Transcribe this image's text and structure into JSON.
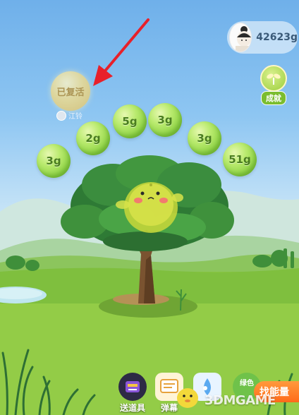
{
  "user": {
    "energy_total": "42623g",
    "avatar": "user-avatar"
  },
  "achievement": {
    "label": "成就",
    "icon": "sprout-medal-icon"
  },
  "revived_ball": {
    "label": "已复活",
    "friend_name": "江铃"
  },
  "energy_balls": [
    "5g",
    "3g",
    "2g",
    "3g",
    "3g",
    "51g"
  ],
  "dock": {
    "send_props": "送道具",
    "bullet": "弹幕",
    "green_tag": "绿色",
    "find_energy": "找能量"
  },
  "watermark": "3DMGAME",
  "colors": {
    "sky": "#6fb0ea",
    "grass": "#8cc63f",
    "energy_ball": "#8fd446",
    "find_energy": "#ff6a1a",
    "arrow": "#e8202a"
  }
}
